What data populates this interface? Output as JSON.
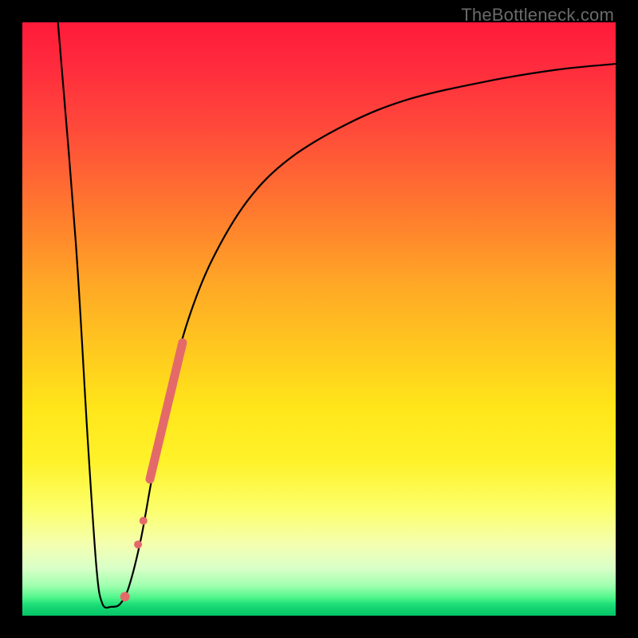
{
  "watermark": "TheBottleneck.com",
  "chart_data": {
    "type": "line",
    "title": "",
    "xlabel": "",
    "ylabel": "",
    "ylim": [
      0,
      100
    ],
    "xlim": [
      0,
      100
    ],
    "curve": [
      {
        "x": 6,
        "y": 100
      },
      {
        "x": 9,
        "y": 63
      },
      {
        "x": 11,
        "y": 30
      },
      {
        "x": 12.5,
        "y": 8
      },
      {
        "x": 13.5,
        "y": 2
      },
      {
        "x": 15,
        "y": 1.5
      },
      {
        "x": 16.5,
        "y": 2
      },
      {
        "x": 18,
        "y": 5
      },
      {
        "x": 20,
        "y": 13
      },
      {
        "x": 22,
        "y": 24
      },
      {
        "x": 25,
        "y": 39
      },
      {
        "x": 28,
        "y": 50
      },
      {
        "x": 32,
        "y": 60
      },
      {
        "x": 38,
        "y": 70
      },
      {
        "x": 45,
        "y": 77
      },
      {
        "x": 55,
        "y": 83
      },
      {
        "x": 65,
        "y": 87
      },
      {
        "x": 78,
        "y": 90
      },
      {
        "x": 90,
        "y": 92
      },
      {
        "x": 100,
        "y": 93
      }
    ],
    "marker_band": {
      "x1": 21.5,
      "y1": 23,
      "x2": 27,
      "y2": 46,
      "width": 11
    },
    "marker_dots": [
      {
        "x": 19.5,
        "y": 12,
        "r": 5
      },
      {
        "x": 20.4,
        "y": 16,
        "r": 5
      },
      {
        "x": 17.3,
        "y": 3.2,
        "r": 6
      }
    ],
    "colors": {
      "marker": "#e46a6a",
      "curve": "#000000",
      "watermark": "#6a6a6a"
    }
  }
}
